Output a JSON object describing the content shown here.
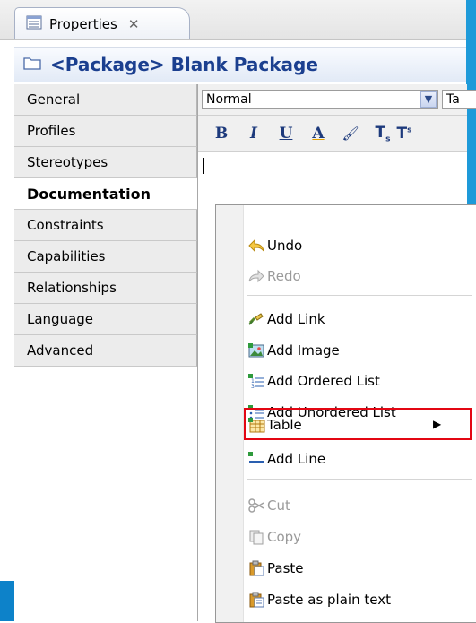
{
  "tab": {
    "label": "Properties",
    "close_glyph": "✕"
  },
  "title": "<Package> Blank Package",
  "sidebar": {
    "items": [
      {
        "label": "General"
      },
      {
        "label": "Profiles"
      },
      {
        "label": "Stereotypes"
      },
      {
        "label": "Documentation"
      },
      {
        "label": "Constraints"
      },
      {
        "label": "Capabilities"
      },
      {
        "label": "Relationships"
      },
      {
        "label": "Language"
      },
      {
        "label": "Advanced"
      }
    ],
    "active_index": 3
  },
  "editor": {
    "format_select": "Normal",
    "second_select": "Ta",
    "toolbar": {
      "bold": "B",
      "italic": "I",
      "underline": "U",
      "font_color": "A",
      "highlight": "fill",
      "subscript": "Ts",
      "superscript": "T"
    }
  },
  "context_menu": {
    "undo": "Undo",
    "redo": "Redo",
    "add_link": "Add Link",
    "add_image": "Add Image",
    "add_ordered_list": "Add Ordered List",
    "add_unordered_list": "Add Unordered List",
    "table": "Table",
    "add_line": "Add Line",
    "cut": "Cut",
    "copy": "Copy",
    "paste": "Paste",
    "paste_plain": "Paste as plain text"
  },
  "colors": {
    "title_blue": "#1b3f8f",
    "highlight_frame": "#e30613",
    "accent_strip": "#1e9ad9"
  }
}
